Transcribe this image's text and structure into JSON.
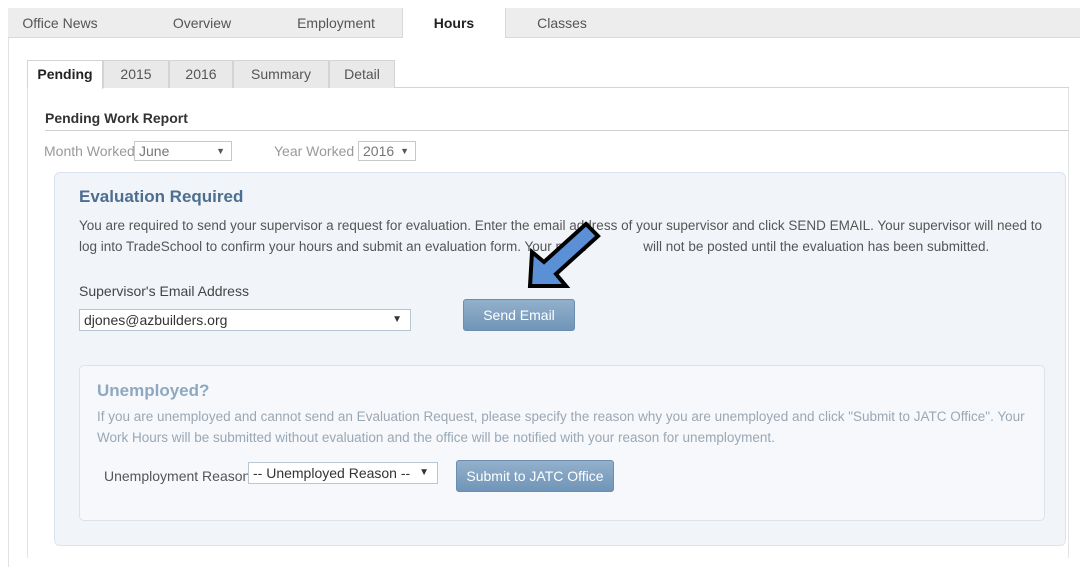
{
  "top_tabs": [
    {
      "label": "Office News"
    },
    {
      "label": "Overview"
    },
    {
      "label": "Employment"
    },
    {
      "label": "Hours"
    },
    {
      "label": "Classes"
    }
  ],
  "sub_tabs": [
    {
      "label": "Pending"
    },
    {
      "label": "2015"
    },
    {
      "label": "2016"
    },
    {
      "label": "Summary"
    },
    {
      "label": "Detail"
    }
  ],
  "section_title": "Pending Work Report",
  "filters": {
    "month_label": "Month Worked",
    "month_value": "June",
    "year_label": "Year Worked",
    "year_value": "2016"
  },
  "evaluation": {
    "title": "Evaluation Required",
    "text_before": "You are required to send your supervisor a request for evaluation. Enter the email address of your supervisor and click SEND EMAIL. Your supervisor will need to log into TradeSchool to confirm your hours and submit an evaluation form. Your mont",
    "text_after": " will not be posted until the evaluation has been submitted.",
    "email_label": "Supervisor's Email Address",
    "email_value": "djones@azbuilders.org",
    "send_button": "Send Email"
  },
  "unemployed": {
    "title": "Unemployed?",
    "text": "If you are unemployed and cannot send an Evaluation Request, please specify the reason why you are unemployed and click \"Submit to JATC Office\". Your Work Hours will be submitted without evaluation and the office will be notified with your reason for unemployment.",
    "reason_label": "Unemployment Reason",
    "reason_value": "-- Unemployed Reason --",
    "submit_button": "Submit to JATC Office"
  },
  "icons": {
    "caret": "▼",
    "arrow": "pointer-arrow-icon"
  },
  "colors": {
    "accent": "#4d6e8f",
    "button": "#7f9fc0",
    "arrow_fill": "#5b8fd6"
  }
}
